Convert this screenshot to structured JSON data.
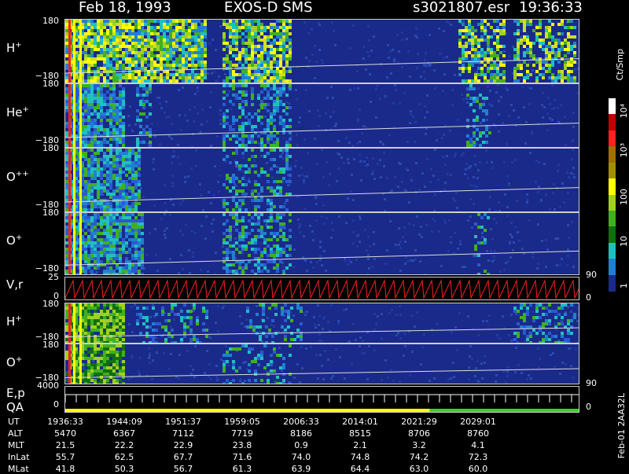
{
  "header": {
    "date": "Feb 18, 1993",
    "title": "EXOS-D SMS",
    "file": "s3021807.esr",
    "time": "19:36:33"
  },
  "panels": [
    {
      "id": "h1",
      "label": "H",
      "charge": "+",
      "ytop": "180",
      "ybot": "−180"
    },
    {
      "id": "he1",
      "label": "He",
      "charge": "+",
      "ytop": "180",
      "ybot": "−180"
    },
    {
      "id": "opp",
      "label": "O",
      "charge": "++",
      "ytop": "180",
      "ybot": "−180"
    },
    {
      "id": "o1",
      "label": "O",
      "charge": "+",
      "ytop": "180",
      "ybot": "−180"
    },
    {
      "id": "vr",
      "label": "V,r",
      "charge": "",
      "ytop": "25",
      "ybot": "0"
    },
    {
      "id": "h2",
      "label": "H",
      "charge": "+",
      "ytop": "180",
      "ybot": "−180"
    },
    {
      "id": "o2",
      "label": "O",
      "charge": "+",
      "ytop": "180",
      "ybot": "−180"
    },
    {
      "id": "ep",
      "label": "E,p",
      "charge": "",
      "ytop": "4000",
      "ybot": "0"
    }
  ],
  "qa_label": "QA",
  "right_ticks": {
    "vr_top": "90",
    "vr_bot": "0",
    "ep_top": "90",
    "ep_bot": "0"
  },
  "colorbar": {
    "unit": "Ct/Smp",
    "labels": [
      "10⁴",
      "10³",
      "100",
      "10",
      "1"
    ],
    "colors": [
      "#ffffff",
      "#c00000",
      "#ff2020",
      "#a07000",
      "#a09000",
      "#ffff00",
      "#a0d020",
      "#40b020",
      "#107010",
      "#20c0c0",
      "#2080d0",
      "#1a2a8a"
    ]
  },
  "footer_code": "Feb-01 2AA32L",
  "ephemeris": {
    "names": [
      "UT",
      "ALT",
      "MLT",
      "InLat",
      "MLat"
    ],
    "times": [
      "1936:33",
      "1944:09",
      "1951:37",
      "1959:05",
      "2006:33",
      "2014:01",
      "2021:29",
      "2029:01"
    ],
    "rows": [
      [
        "5470",
        "6367",
        "7112",
        "7719",
        "8186",
        "8515",
        "8706",
        "8760"
      ],
      [
        "21.5",
        "22.2",
        "22.9",
        "23.8",
        "0.9",
        "2.1",
        "3.2",
        "4.1"
      ],
      [
        "55.7",
        "62.5",
        "67.7",
        "71.6",
        "74.0",
        "74.8",
        "74.2",
        "72.3"
      ],
      [
        "41.8",
        "50.3",
        "56.7",
        "61.3",
        "63.9",
        "64.4",
        "63.0",
        "60.0"
      ]
    ]
  }
}
